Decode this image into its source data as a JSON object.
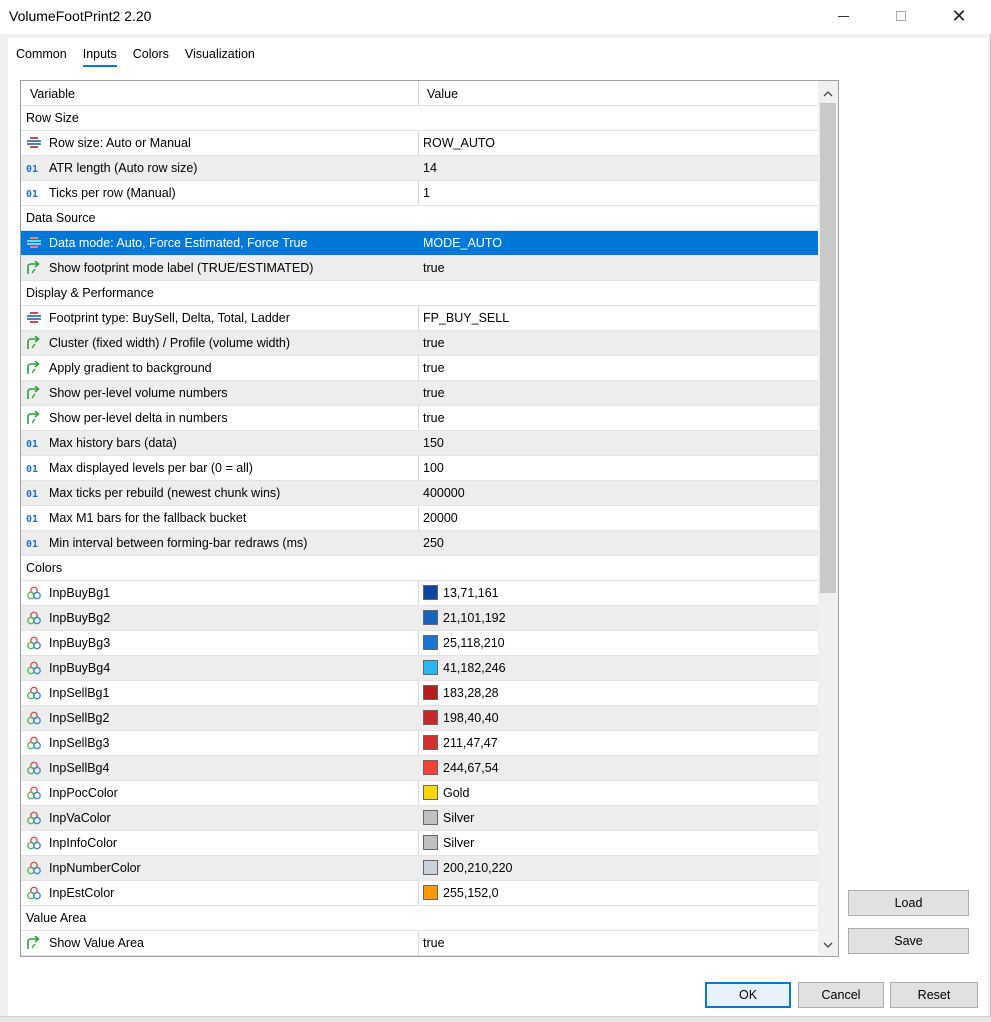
{
  "window": {
    "title": "VolumeFootPrint2 2.20"
  },
  "tabs": [
    "Common",
    "Inputs",
    "Colors",
    "Visualization"
  ],
  "active_tab": "Inputs",
  "grid": {
    "headers": {
      "variable": "Variable",
      "value": "Value"
    },
    "rows": [
      {
        "type": "group",
        "label": "Row Size",
        "value": ""
      },
      {
        "type": "enum",
        "label": "Row size: Auto or Manual",
        "value": "ROW_AUTO"
      },
      {
        "type": "int",
        "label": "ATR length (Auto row size)",
        "value": "14"
      },
      {
        "type": "int",
        "label": "Ticks per row (Manual)",
        "value": "1"
      },
      {
        "type": "group",
        "label": "Data Source",
        "value": ""
      },
      {
        "type": "enum",
        "label": "Data mode: Auto, Force Estimated, Force True",
        "value": "MODE_AUTO",
        "selected": true
      },
      {
        "type": "bool",
        "label": "Show footprint mode label (TRUE/ESTIMATED)",
        "value": "true"
      },
      {
        "type": "group",
        "label": "Display & Performance",
        "value": ""
      },
      {
        "type": "enum",
        "label": "Footprint type: BuySell, Delta, Total, Ladder",
        "value": "FP_BUY_SELL"
      },
      {
        "type": "bool",
        "label": "Cluster (fixed width) / Profile (volume width)",
        "value": "true"
      },
      {
        "type": "bool",
        "label": "Apply gradient to background",
        "value": "true"
      },
      {
        "type": "bool",
        "label": "Show per-level volume numbers",
        "value": "true"
      },
      {
        "type": "bool",
        "label": "Show per-level delta in numbers",
        "value": "true"
      },
      {
        "type": "int",
        "label": "Max history bars (data)",
        "value": "150"
      },
      {
        "type": "int",
        "label": "Max displayed levels per bar (0 = all)",
        "value": "100"
      },
      {
        "type": "int",
        "label": "Max ticks per rebuild (newest chunk wins)",
        "value": "400000"
      },
      {
        "type": "int",
        "label": "Max M1 bars for the fallback bucket",
        "value": "20000"
      },
      {
        "type": "int",
        "label": "Min interval between forming-bar redraws (ms)",
        "value": "250"
      },
      {
        "type": "group",
        "label": "Colors",
        "value": ""
      },
      {
        "type": "color",
        "label": "InpBuyBg1",
        "value": "13,71,161",
        "swatch": "#0d47a1"
      },
      {
        "type": "color",
        "label": "InpBuyBg2",
        "value": "21,101,192",
        "swatch": "#1565c0"
      },
      {
        "type": "color",
        "label": "InpBuyBg3",
        "value": "25,118,210",
        "swatch": "#1976d2"
      },
      {
        "type": "color",
        "label": "InpBuyBg4",
        "value": "41,182,246",
        "swatch": "#29b6f6"
      },
      {
        "type": "color",
        "label": "InpSellBg1",
        "value": "183,28,28",
        "swatch": "#b71c1c"
      },
      {
        "type": "color",
        "label": "InpSellBg2",
        "value": "198,40,40",
        "swatch": "#c62828"
      },
      {
        "type": "color",
        "label": "InpSellBg3",
        "value": "211,47,47",
        "swatch": "#d32f2f"
      },
      {
        "type": "color",
        "label": "InpSellBg4",
        "value": "244,67,54",
        "swatch": "#f44336"
      },
      {
        "type": "color",
        "label": "InpPocColor",
        "value": "Gold",
        "swatch": "#ffd700"
      },
      {
        "type": "color",
        "label": "InpVaColor",
        "value": "Silver",
        "swatch": "#c0c0c0"
      },
      {
        "type": "color",
        "label": "InpInfoColor",
        "value": "Silver",
        "swatch": "#c0c0c0"
      },
      {
        "type": "color",
        "label": "InpNumberColor",
        "value": "200,210,220",
        "swatch": "#c8d2dc"
      },
      {
        "type": "color",
        "label": "InpEstColor",
        "value": "255,152,0",
        "swatch": "#ff9800"
      },
      {
        "type": "group",
        "label": "Value Area",
        "value": ""
      },
      {
        "type": "bool",
        "label": "Show Value Area",
        "value": "true"
      }
    ]
  },
  "buttons": {
    "load": "Load",
    "save": "Save",
    "ok": "OK",
    "cancel": "Cancel",
    "reset": "Reset"
  },
  "icons": {
    "enum": "enum-list-icon",
    "int": "integer-icon",
    "bool": "boolean-arrow-icon",
    "color": "color-circles-icon"
  },
  "colors": {
    "accent": "#0078d7",
    "selection": "#0078d7"
  }
}
